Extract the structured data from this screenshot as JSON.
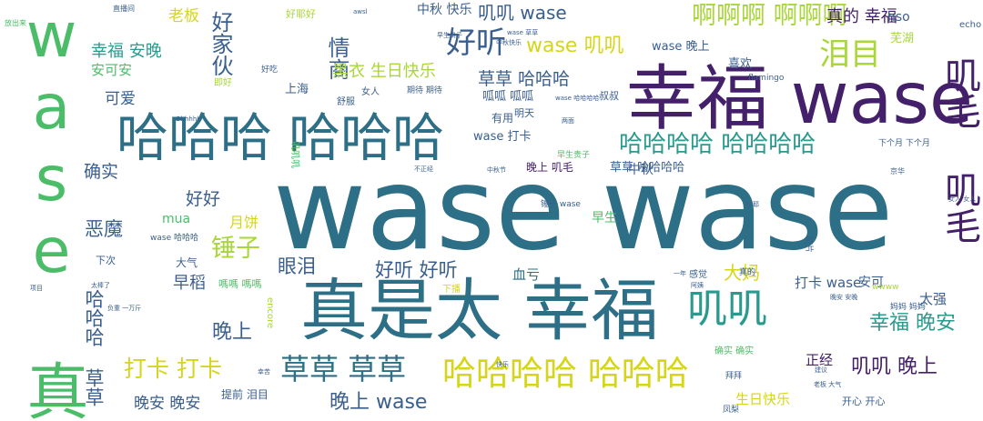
{
  "palette": {
    "purple": "#44206b",
    "blue": "#3a5f8f",
    "teal": "#2d6f86",
    "cyan": "#2a9a8e",
    "green": "#4bbd68",
    "lime": "#a9d63a",
    "yellow": "#d6d51a"
  },
  "words": [
    {
      "text": "wase wase",
      "color": "#2d6f86"
    },
    {
      "text": "幸福 wase",
      "color": "#44206b"
    },
    {
      "text": "真是太 幸福",
      "color": "#2d6f86"
    },
    {
      "text": "哈哈哈 哈哈哈",
      "color": "#2d6f86"
    },
    {
      "text": "wase 真是太",
      "color": "#4bbd68"
    },
    {
      "text": "叽毛 叽毛",
      "color": "#44206b"
    },
    {
      "text": "哈哈哈哈 哈哈哈",
      "color": "#d6d51a"
    },
    {
      "text": "哈哈哈哈 哈哈哈哈",
      "color": "#2a9a8e"
    },
    {
      "text": "啊啊啊 啊啊啊",
      "color": "#a9d63a"
    },
    {
      "text": "叽叽",
      "color": "#2a9a8e"
    },
    {
      "text": "草草 草草",
      "color": "#2d6f86"
    },
    {
      "text": "好听",
      "color": "#3a5f8f"
    },
    {
      "text": "泪目",
      "color": "#a9d63a"
    },
    {
      "text": "wase 叽叽",
      "color": "#d6d51a"
    },
    {
      "text": "叽叽 wase",
      "color": "#3a5f8f"
    },
    {
      "text": "幸福 晚安",
      "color": "#2a9a8e"
    },
    {
      "text": "晚上 wase",
      "color": "#3a5f8f"
    },
    {
      "text": "叽叽 晚上",
      "color": "#44206b"
    },
    {
      "text": "锤子",
      "color": "#a9d63a"
    },
    {
      "text": "打卡 打卡",
      "color": "#d6d51a"
    },
    {
      "text": "晚上",
      "color": "#3a5f8f"
    },
    {
      "text": "哈哈哈 草草",
      "color": "#3a5f8f"
    },
    {
      "text": "好家伙",
      "color": "#3a5f8f"
    },
    {
      "text": "情商",
      "color": "#3a5f8f"
    },
    {
      "text": "真的 幸福",
      "color": "#44206b"
    },
    {
      "text": "黑衣 生日快乐",
      "color": "#a9d63a"
    },
    {
      "text": "草草 哈哈哈",
      "color": "#3a5f8f"
    },
    {
      "text": "好听 好听",
      "color": "#3a5f8f"
    },
    {
      "text": "眼泪",
      "color": "#3a5f8f"
    },
    {
      "text": "幸福 安晚",
      "color": "#2a9a8e"
    },
    {
      "text": "确实",
      "color": "#3a5f8f"
    },
    {
      "text": "恶魔",
      "color": "#3a5f8f"
    },
    {
      "text": "好好",
      "color": "#3a5f8f"
    },
    {
      "text": "早稻",
      "color": "#3a5f8f"
    },
    {
      "text": "大妈",
      "color": "#d6d51a"
    },
    {
      "text": "晚安 晚安",
      "color": "#3a5f8f"
    },
    {
      "text": "打卡 wase",
      "color": "#3a5f8f"
    },
    {
      "text": "生日快乐",
      "color": "#d6d51a"
    },
    {
      "text": "中秋 快乐",
      "color": "#3a5f8f"
    },
    {
      "text": "老板",
      "color": "#d6d51a"
    },
    {
      "text": "可爱",
      "color": "#3a5f8f"
    },
    {
      "text": "安可安",
      "color": "#4bbd68"
    },
    {
      "text": "月饼",
      "color": "#d6d51a"
    },
    {
      "text": "mua",
      "color": "#4bbd68"
    },
    {
      "text": "血亏",
      "color": "#2d6f86"
    },
    {
      "text": "wase 晚上",
      "color": "#3a5f8f"
    },
    {
      "text": "中秋",
      "color": "#3a5f8f"
    },
    {
      "text": "早生",
      "color": "#4bbd68"
    },
    {
      "text": "正经",
      "color": "#44206b"
    },
    {
      "text": "太强",
      "color": "#3a5f8f"
    },
    {
      "text": "安可",
      "color": "#3a5f8f"
    },
    {
      "text": "提前 泪目",
      "color": "#3a5f8f"
    },
    {
      "text": "开心 开心",
      "color": "#3a5f8f"
    },
    {
      "text": "wase 打卡",
      "color": "#3a5f8f"
    },
    {
      "text": "晚上 叽毛",
      "color": "#44206b"
    },
    {
      "text": "草草 哈哈哈哈",
      "color": "#3a5f8f"
    },
    {
      "text": "喜欢",
      "color": "#3a5f8f"
    },
    {
      "text": "芜湖",
      "color": "#a9d63a"
    },
    {
      "text": "hso",
      "color": "#3a5f8f"
    },
    {
      "text": "呱呱 呱呱",
      "color": "#3a5f8f"
    },
    {
      "text": "上海",
      "color": "#3a5f8f"
    },
    {
      "text": "有用",
      "color": "#3a5f8f"
    },
    {
      "text": "明天",
      "color": "#3a5f8f"
    },
    {
      "text": "叔叔",
      "color": "#3a5f8f"
    },
    {
      "text": "下次",
      "color": "#3a5f8f"
    },
    {
      "text": "嗎嗎 嗎嗎",
      "color": "#4bbd68"
    },
    {
      "text": "大气",
      "color": "#3a5f8f"
    },
    {
      "text": "wase 哈哈哈",
      "color": "#3a5f8f"
    },
    {
      "text": "好耶好",
      "color": "#a9d63a"
    },
    {
      "text": "舒服",
      "color": "#3a5f8f"
    },
    {
      "text": "女人",
      "color": "#3a5f8f"
    },
    {
      "text": "期待 期待",
      "color": "#3a5f8f"
    },
    {
      "text": "encore",
      "color": "#a9d63a"
    },
    {
      "text": "wwww",
      "color": "#a9d63a"
    },
    {
      "text": "妈妈 妈妈",
      "color": "#3a5f8f"
    },
    {
      "text": "确实 确实",
      "color": "#4bbd68"
    },
    {
      "text": "感觉",
      "color": "#3a5f8f"
    },
    {
      "text": "真的",
      "color": "#3a5f8f"
    },
    {
      "text": "拜拜",
      "color": "#3a5f8f"
    },
    {
      "text": "凤梨",
      "color": "#3a5f8f"
    },
    {
      "text": "锤子 wase",
      "color": "#3a5f8f"
    },
    {
      "text": "早生贵子",
      "color": "#4bbd68"
    },
    {
      "text": "echo",
      "color": "#3a5f8f"
    },
    {
      "text": "flamingo",
      "color": "#3a5f8f"
    },
    {
      "text": "下个月 下个月",
      "color": "#3a5f8f"
    },
    {
      "text": "京华",
      "color": "#3a5f8f"
    },
    {
      "text": "即好",
      "color": "#a9d63a"
    },
    {
      "text": "好吃",
      "color": "#3a5f8f"
    },
    {
      "text": "wase 哈哈哈哈",
      "color": "#3a5f8f"
    },
    {
      "text": "放出来",
      "color": "#4bbd68"
    },
    {
      "text": "直播间",
      "color": "#3a5f8f"
    },
    {
      "text": "太棒了",
      "color": "#3a5f8f"
    },
    {
      "text": "负重 一万斤",
      "color": "#3a5f8f"
    },
    {
      "text": "幸苦",
      "color": "#3a5f8f"
    },
    {
      "text": "不正经",
      "color": "#3a5f8f"
    },
    {
      "text": "中秋节",
      "color": "#3a5f8f"
    },
    {
      "text": "老板 大气",
      "color": "#3a5f8f"
    },
    {
      "text": "一年",
      "color": "#3a5f8f"
    },
    {
      "text": "阿姨",
      "color": "#3a5f8f"
    },
    {
      "text": "好耶",
      "color": "#3a5f8f"
    },
    {
      "text": "晚安 安晚",
      "color": "#3a5f8f"
    },
    {
      "text": "两面",
      "color": "#3a5f8f"
    },
    {
      "text": "切片",
      "color": "#3a5f8f"
    },
    {
      "text": "项目",
      "color": "#3a5f8f"
    },
    {
      "text": "快乐",
      "color": "#3a5f8f"
    },
    {
      "text": "下播",
      "color": "#d6d51a"
    },
    {
      "text": "wase 草草",
      "color": "#3a5f8f"
    },
    {
      "text": "Ohhhhh",
      "color": "#3a5f8f"
    },
    {
      "text": "awsl",
      "color": "#3a5f8f"
    },
    {
      "text": "女人 女人",
      "color": "#3a5f8f"
    },
    {
      "text": "建议",
      "color": "#3a5f8f"
    },
    {
      "text": "叽叽叽",
      "color": "#4bbd68"
    },
    {
      "text": "早生贵子",
      "color": "#3a5f8f"
    },
    {
      "text": "中秋快乐",
      "color": "#3a5f8f"
    }
  ]
}
